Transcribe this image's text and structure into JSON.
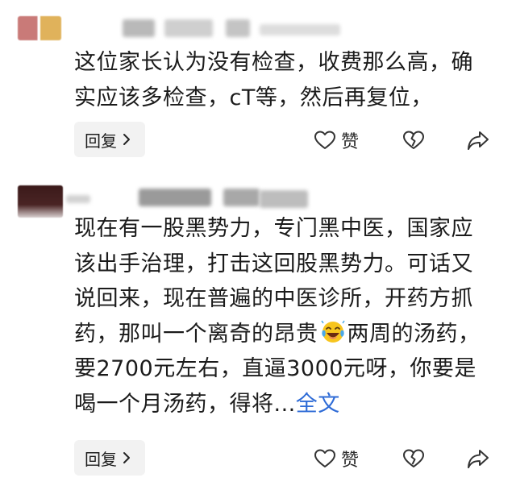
{
  "comments": [
    {
      "text": "这位家长认为没有检查，收费那么高，确实应该多检查，cT等，然后再复位，",
      "reply_label": "回复",
      "like_label": "赞"
    },
    {
      "text_before_emoji": "现在有一股黑势力，专门黑中医，国家应该出手治理，打击这回股黑势力。可话又说回来，现在普遍的中医诊所，开药方抓药，那叫一个离奇的昂贵",
      "text_after_emoji": "两周的汤药，要2700元左右，直逼3000元呀，你要是喝一个月汤药，得将...",
      "full_text_link": "全文",
      "reply_label": "回复",
      "like_label": "赞"
    }
  ],
  "icons": {
    "like": "heart-outline-icon",
    "dislike": "broken-heart-icon",
    "share": "share-arrow-icon",
    "emoji": "crying-laughing-emoji-icon",
    "reply_chevron": "chevron-right-icon"
  },
  "colors": {
    "link": "#2e6bd6",
    "reply_bg": "#f2f2f2",
    "text": "#1b1b1b"
  }
}
